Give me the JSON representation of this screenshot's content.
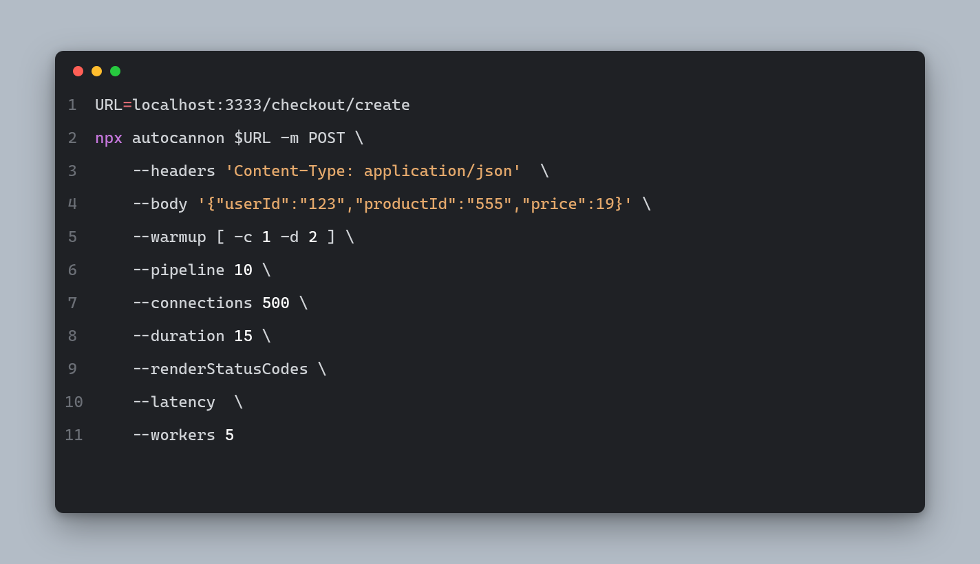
{
  "window": {
    "dots": [
      "red",
      "yellow",
      "green"
    ]
  },
  "code": {
    "lines": [
      {
        "n": "1",
        "tokens": [
          {
            "cls": "tok-var",
            "t": "URL"
          },
          {
            "cls": "tok-op",
            "t": "="
          },
          {
            "cls": "tok-url",
            "t": "localhost:3333/checkout/create"
          }
        ]
      },
      {
        "n": "2",
        "tokens": [
          {
            "cls": "tok-kw",
            "t": "npx"
          },
          {
            "cls": "",
            "t": " "
          },
          {
            "cls": "tok-cmd",
            "t": "autocannon $URL -m POST "
          },
          {
            "cls": "tok-cont",
            "t": "\\"
          }
        ]
      },
      {
        "n": "3",
        "tokens": [
          {
            "cls": "",
            "t": "    --headers "
          },
          {
            "cls": "tok-str",
            "t": "'Content-Type: application/json'"
          },
          {
            "cls": "",
            "t": "  "
          },
          {
            "cls": "tok-cont",
            "t": "\\"
          }
        ]
      },
      {
        "n": "4",
        "tokens": [
          {
            "cls": "",
            "t": "    --body "
          },
          {
            "cls": "tok-str",
            "t": "'{\"userId\":\"123\",\"productId\":\"555\",\"price\":19}'"
          },
          {
            "cls": "",
            "t": " "
          },
          {
            "cls": "tok-cont",
            "t": "\\"
          }
        ]
      },
      {
        "n": "5",
        "tokens": [
          {
            "cls": "",
            "t": "    --warmup [ -c "
          },
          {
            "cls": "tok-num",
            "t": "1"
          },
          {
            "cls": "",
            "t": " -d "
          },
          {
            "cls": "tok-num",
            "t": "2"
          },
          {
            "cls": "",
            "t": " ] "
          },
          {
            "cls": "tok-cont",
            "t": "\\"
          }
        ]
      },
      {
        "n": "6",
        "tokens": [
          {
            "cls": "",
            "t": "    --pipeline "
          },
          {
            "cls": "tok-num",
            "t": "10"
          },
          {
            "cls": "",
            "t": " "
          },
          {
            "cls": "tok-cont",
            "t": "\\"
          }
        ]
      },
      {
        "n": "7",
        "tokens": [
          {
            "cls": "",
            "t": "    --connections "
          },
          {
            "cls": "tok-num",
            "t": "500"
          },
          {
            "cls": "",
            "t": " "
          },
          {
            "cls": "tok-cont",
            "t": "\\"
          }
        ]
      },
      {
        "n": "8",
        "tokens": [
          {
            "cls": "",
            "t": "    --duration "
          },
          {
            "cls": "tok-num",
            "t": "15"
          },
          {
            "cls": "",
            "t": " "
          },
          {
            "cls": "tok-cont",
            "t": "\\"
          }
        ]
      },
      {
        "n": "9",
        "tokens": [
          {
            "cls": "",
            "t": "    --renderStatusCodes "
          },
          {
            "cls": "tok-cont",
            "t": "\\"
          }
        ]
      },
      {
        "n": "10",
        "tokens": [
          {
            "cls": "",
            "t": "    --latency  "
          },
          {
            "cls": "tok-cont",
            "t": "\\"
          }
        ]
      },
      {
        "n": "11",
        "tokens": [
          {
            "cls": "",
            "t": "    --workers "
          },
          {
            "cls": "tok-num",
            "t": "5"
          }
        ]
      }
    ]
  }
}
